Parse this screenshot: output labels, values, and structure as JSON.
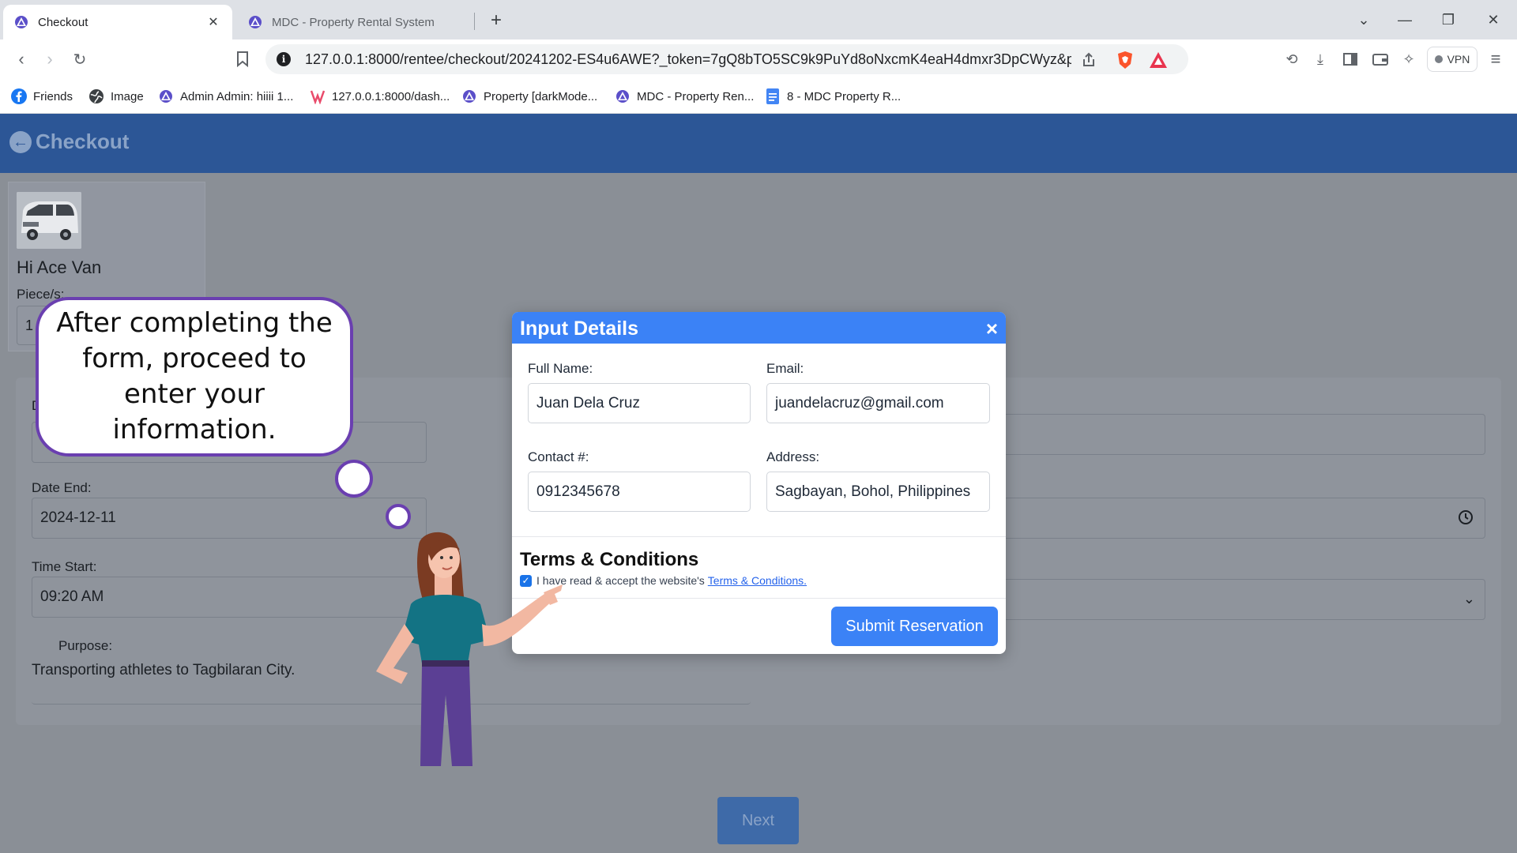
{
  "browser": {
    "tabs": [
      {
        "label": "Checkout",
        "active": true
      },
      {
        "label": "MDC - Property Rental System",
        "active": false
      }
    ],
    "url": "127.0.0.1:8000/rentee/checkout/20241202-ES4u6AWE?_token=7gQ8bTO5SC9k9PuYd8oNxcmK4eaH4dmxr3DpCWyz&prope...",
    "vpn_label": "VPN",
    "bookmarks": [
      {
        "label": "Friends",
        "icon": "facebook-icon"
      },
      {
        "label": "Image",
        "icon": "globe-icon"
      },
      {
        "label": "Admin Admin: hiiii 1...",
        "icon": "mdc-logo-icon"
      },
      {
        "label": "127.0.0.1:8000/dash...",
        "icon": "bookmark-logo-icon"
      },
      {
        "label": "Property [darkMode...",
        "icon": "mdc-logo-icon"
      },
      {
        "label": "MDC - Property Ren...",
        "icon": "mdc-logo-icon"
      },
      {
        "label": "8 - MDC Property R...",
        "icon": "docs-icon"
      }
    ]
  },
  "page": {
    "title": "Checkout",
    "product": {
      "name": "Hi Ace Van",
      "pieces_label": "Piece/s:",
      "pieces_value": "1"
    },
    "form": {
      "partial_label": "D",
      "date_end_label": "Date End:",
      "date_end_value": "2024-12-11",
      "time_start_label": "Time Start:",
      "time_start_value": "09:20  AM",
      "purpose_label": "Purpose:",
      "purpose_value": "Transporting athletes to Tagbilaran City."
    },
    "next_label": "Next"
  },
  "modal": {
    "title": "Input Details",
    "close_glyph": "×",
    "full_name_label": "Full Name:",
    "full_name_value": "Juan Dela Cruz",
    "email_label": "Email:",
    "email_value": "juandelacruz@gmail.com",
    "contact_label": "Contact #:",
    "contact_value": "0912345678",
    "address_label": "Address:",
    "address_value": "Sagbayan, Bohol, Philippines",
    "terms_title": "Terms & Conditions",
    "terms_text": "I have read & accept the website's",
    "terms_link": "Terms & Conditions.",
    "terms_checked": true,
    "submit_label": "Submit Reservation"
  },
  "tutorial": {
    "bubble_text": "After completing the form, proceed to enter your information."
  },
  "colors": {
    "header_blue": "#2c5696",
    "modal_blue": "#3b82f6",
    "bubble_purple": "#6a3fb0",
    "overlay_gray": "#8a8f96"
  }
}
